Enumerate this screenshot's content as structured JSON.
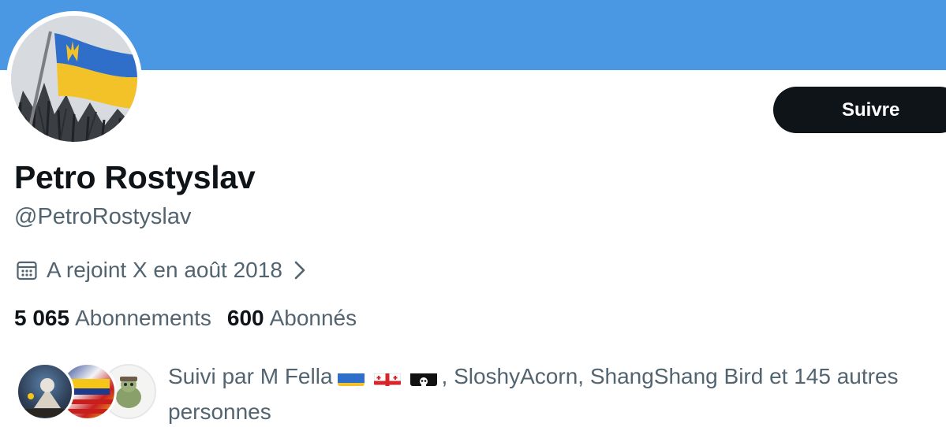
{
  "profile": {
    "name": "Petro Rostyslav",
    "handle": "@PetroRostyslav",
    "joined": "A rejoint X en août 2018"
  },
  "actions": {
    "follow_label": "Suivre"
  },
  "stats": {
    "following_count": "5 065",
    "following_label": "Abonnements",
    "followers_count": "600",
    "followers_label": "Abonnés"
  },
  "followed_by": {
    "prefix": "Suivi par M Fella",
    "suffix": ", SloshyAcorn, ShangShang Bird et 145 autres personnes",
    "flags": [
      "ukraine-flag",
      "georgia-flag",
      "pirate-flag"
    ]
  },
  "colors": {
    "banner": "#4a97e3",
    "button": "#0f1419",
    "secondary_text": "#536471"
  }
}
